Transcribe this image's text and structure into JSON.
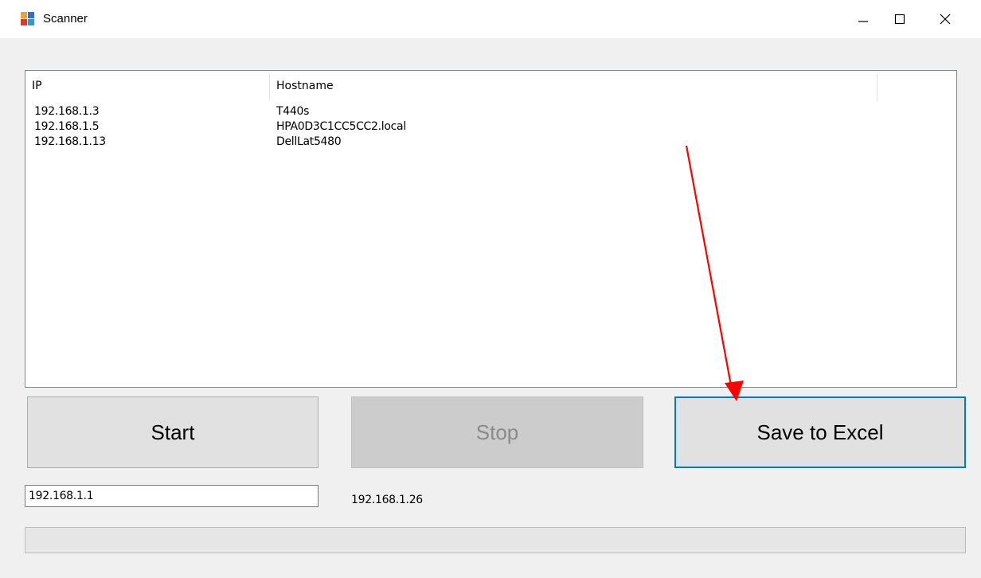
{
  "window": {
    "title": "Scanner"
  },
  "listview": {
    "columns": [
      "IP",
      "Hostname",
      ""
    ],
    "rows": [
      {
        "ip": "192.168.1.3",
        "hostname": "T440s"
      },
      {
        "ip": "192.168.1.5",
        "hostname": "HPA0D3C1CC5CC2.local"
      },
      {
        "ip": "192.168.1.13",
        "hostname": "DellLat5480"
      }
    ]
  },
  "buttons": {
    "start_label": "Start",
    "stop_label": "Stop",
    "save_label": "Save to Excel"
  },
  "scan": {
    "start_ip": "192.168.1.1",
    "current_ip": "192.168.1.26",
    "progress": 0
  },
  "colors": {
    "focus_border": "#0078d7",
    "annotation_arrow": "#ff0000"
  },
  "icons": {
    "app": "app-window-icon",
    "minimize": "minimize-icon",
    "maximize": "maximize-icon",
    "close": "close-icon",
    "annotation": "red-arrow-annotation"
  }
}
